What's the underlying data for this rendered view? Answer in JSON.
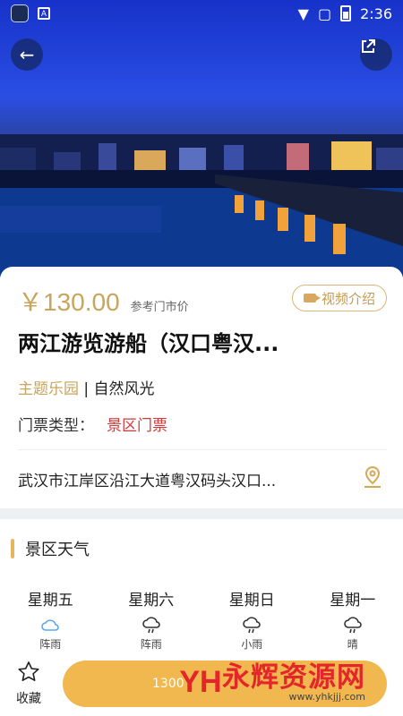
{
  "status_bar": {
    "time": "2:36",
    "notif_icon": "A"
  },
  "hero": {
    "back_icon": "arrow-left-icon",
    "share_icon": "share-external-icon"
  },
  "detail": {
    "price": "￥130.00",
    "price_note": "参考门市价",
    "video_button": "视频介绍",
    "title": "两江游览游船（汉口粤汉...",
    "tag_theme": "主题乐园",
    "tag_sep": " | ",
    "tag_nature": "自然风光",
    "ticket_label": "门票类型：",
    "ticket_value": "景区门票",
    "address": "武汉市江岸区沿江大道粤汉码头汉口..."
  },
  "weather": {
    "section_title": "景区天气",
    "days": [
      {
        "name": "星期五",
        "desc": "阵雨",
        "icon": "cloud-icon"
      },
      {
        "name": "星期六",
        "desc": "阵雨",
        "icon": "rain-icon"
      },
      {
        "name": "星期日",
        "desc": "小雨",
        "icon": "rain-icon"
      },
      {
        "name": "星期一",
        "desc": "晴",
        "icon": "rain-icon"
      }
    ]
  },
  "bottom_bar": {
    "favorite_label": "收藏",
    "book_button": "1300",
    "watermark_text": "永辉资源网",
    "watermark_url": "www.yhkjjj.com",
    "watermark_logo": "YH"
  },
  "colors": {
    "accent": "#c9a45c",
    "red": "#d33a3a",
    "button": "#f0b84e"
  }
}
